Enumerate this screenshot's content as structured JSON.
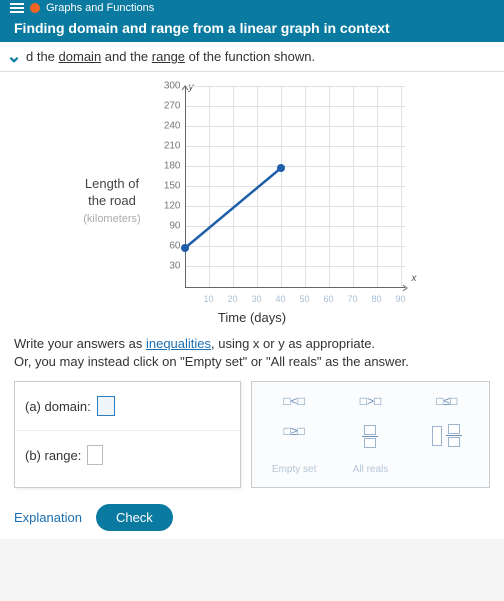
{
  "header": {
    "breadcrumb": "Graphs and Functions",
    "title": "Finding domain and range from a linear graph in context"
  },
  "prompt": "d the domain and the range of the function shown.",
  "chart_data": {
    "type": "line",
    "title": "",
    "xlabel": "Time (days)",
    "ylabel": "Length of the road (kilometers)",
    "xlim": [
      0,
      90
    ],
    "ylim": [
      0,
      300
    ],
    "x_ticks": [
      10,
      20,
      30,
      40,
      50,
      60,
      70,
      80,
      90
    ],
    "y_ticks": [
      30,
      60,
      90,
      120,
      150,
      180,
      210,
      240,
      270,
      300
    ],
    "series": [
      {
        "name": "road length",
        "x": [
          0,
          40
        ],
        "y": [
          60,
          180
        ]
      }
    ],
    "endpoints": [
      {
        "x": 0,
        "y": 60,
        "filled": true
      },
      {
        "x": 40,
        "y": 180,
        "filled": true
      }
    ]
  },
  "instructions": {
    "line1_a": "Write your answers as ",
    "line1_link": "inequalities",
    "line1_b": ", using x or y as appropriate.",
    "line2": "Or, you may instead click on \"Empty set\" or \"All reals\" as the answer."
  },
  "questions": {
    "a": "(a) domain:",
    "b": "(b) range:"
  },
  "palette": {
    "lt": "□<□",
    "gt": "□>□",
    "le": "□≤□",
    "ge": "□≥□",
    "frac": "frac",
    "mixed": "mixed",
    "empty": "Empty set",
    "allreals": "All reals"
  },
  "buttons": {
    "explanation": "Explanation",
    "check": "Check"
  }
}
